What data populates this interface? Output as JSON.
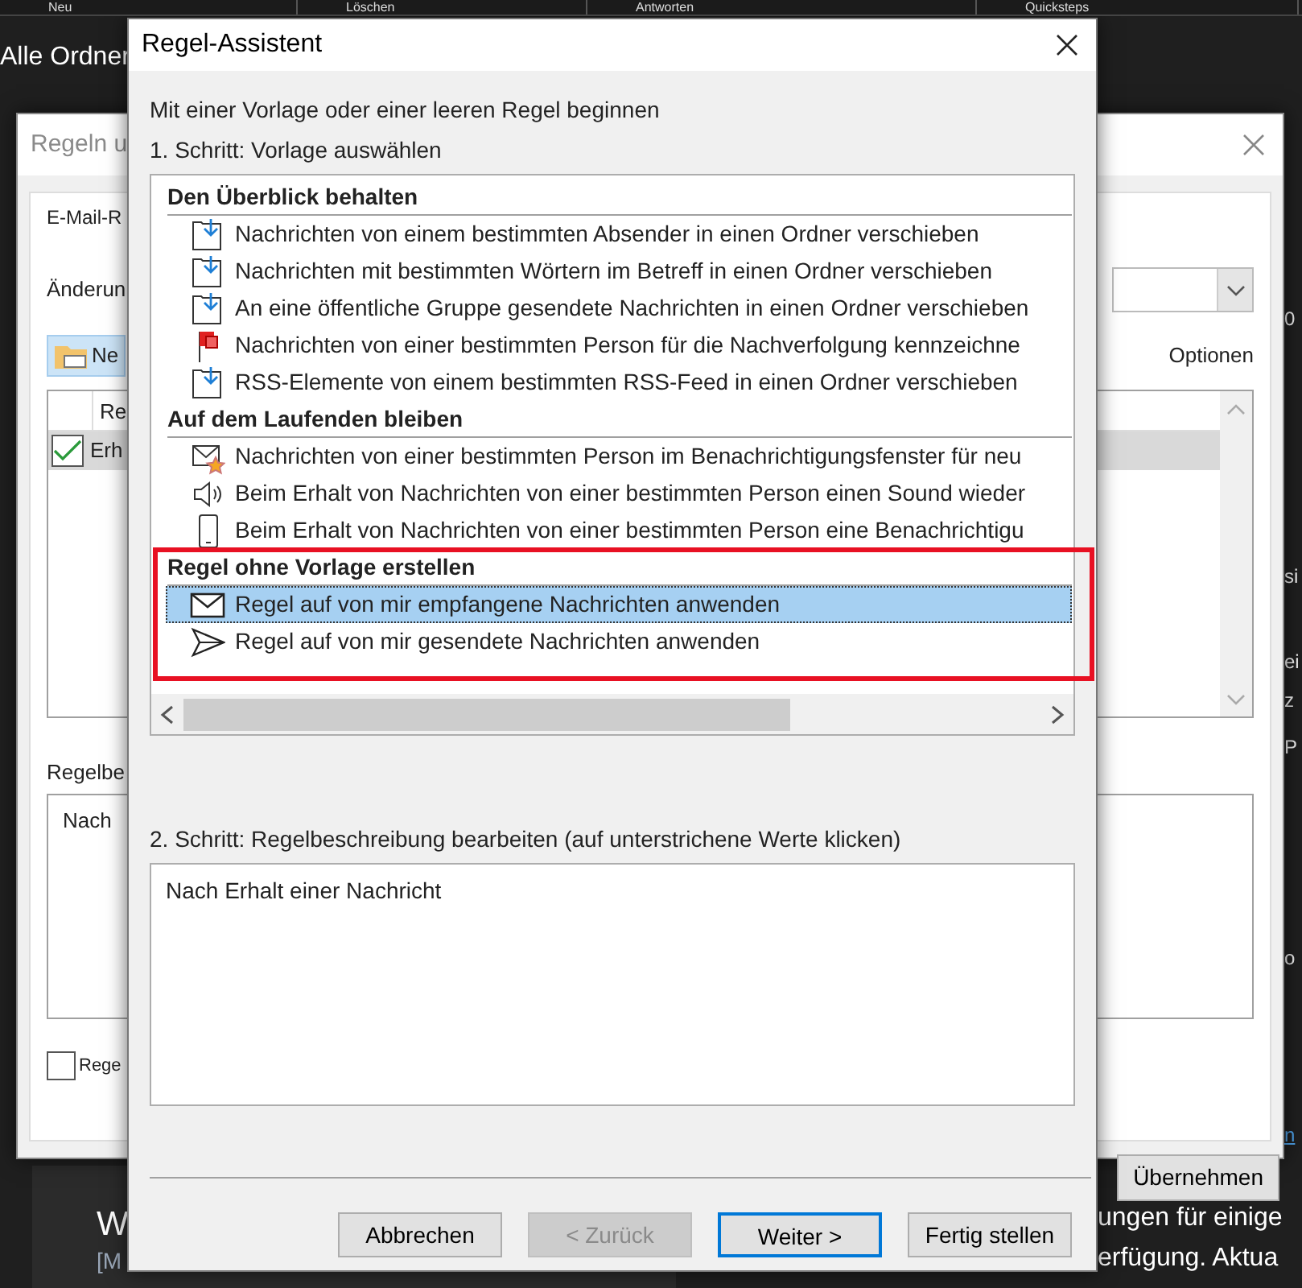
{
  "mail_app": {
    "toolbar": [
      "Neu",
      "Löschen",
      "Antworten",
      "Quicksteps"
    ],
    "folder_pane_title": "Alle Ordner",
    "side_text": [
      "0",
      "si",
      "ei",
      "z",
      "P",
      "o"
    ],
    "side_link": "n",
    "message_title": "W",
    "message_sender": "[M",
    "info_lines": [
      "ungen für einige",
      "erfügung. Aktua"
    ]
  },
  "rules_window": {
    "title": "Regeln u",
    "tab": "E-Mail-R",
    "change_label": "Änderun",
    "new_button": "Ne",
    "options_link": "Optionen",
    "columns": [
      "Re"
    ],
    "rows": [
      {
        "name": "Erh",
        "checked": true,
        "selected": true
      }
    ],
    "description_label": "Regelbe",
    "description": "Nach",
    "checkbox": {
      "label": "Rege",
      "checked": false
    },
    "apply_button": "Übernehmen"
  },
  "wizard": {
    "title": "Regel-Assistent",
    "intro": "Mit einer Vorlage oder einer leeren Regel beginnen",
    "step1_label": "1. Schritt: Vorlage auswählen",
    "groups": [
      {
        "title": "Den Überblick behalten",
        "highlighted": false,
        "items": [
          {
            "label": "Nachrichten von einem bestimmten Absender in einen Ordner verschieben",
            "kind": "move",
            "selected": false
          },
          {
            "label": "Nachrichten mit bestimmten Wörtern im Betreff in einen Ordner verschieben",
            "kind": "move",
            "selected": false
          },
          {
            "label": "An eine öffentliche Gruppe gesendete Nachrichten in einen Ordner verschieben",
            "kind": "move",
            "selected": false
          },
          {
            "label": "Nachrichten von einer bestimmten Person für die Nachverfolgung kennzeichne",
            "kind": "flag",
            "selected": false
          },
          {
            "label": "RSS-Elemente von einem bestimmten RSS-Feed in einen Ordner verschieben",
            "kind": "move",
            "selected": false
          }
        ]
      },
      {
        "title": "Auf dem Laufenden bleiben",
        "highlighted": false,
        "items": [
          {
            "label": "Nachrichten von einer bestimmten Person im Benachrichtigungsfenster für neu",
            "kind": "alert",
            "selected": false
          },
          {
            "label": "Beim Erhalt von Nachrichten von einer bestimmten Person einen Sound wieder",
            "kind": "sound",
            "selected": false
          },
          {
            "label": "Beim Erhalt von Nachrichten von einer bestimmten Person eine Benachrichtigu",
            "kind": "phone",
            "selected": false
          }
        ]
      },
      {
        "title": "Regel ohne Vorlage erstellen",
        "highlighted": true,
        "items": [
          {
            "label": "Regel auf von mir empfangene Nachrichten anwenden",
            "kind": "envelope",
            "selected": true
          },
          {
            "label": "Regel auf von mir gesendete Nachrichten anwenden",
            "kind": "send",
            "selected": false
          }
        ]
      }
    ],
    "step2_label": "2. Schritt: Regelbeschreibung bearbeiten (auf unterstrichene Werte klicken)",
    "description": "Nach Erhalt einer Nachricht",
    "buttons": [
      {
        "label": "Abbrechen",
        "disabled": false,
        "default": false
      },
      {
        "label": "< Zurück",
        "disabled": true,
        "default": false
      },
      {
        "label": "Weiter >",
        "disabled": false,
        "default": true
      },
      {
        "label": "Fertig stellen",
        "disabled": false,
        "default": false
      }
    ]
  }
}
